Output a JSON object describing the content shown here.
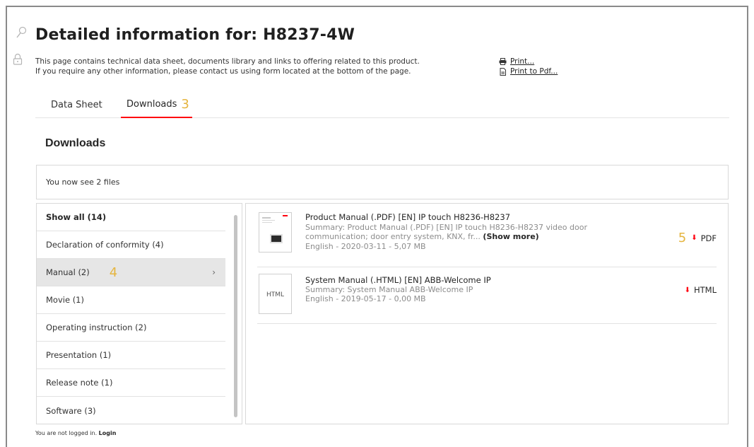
{
  "header": {
    "title": "Detailed information for: H8237-4W",
    "description_line1": "This page contains technical data sheet, documents library and links to offering related to this product.",
    "description_line2": "If you require any other information, please contact us using form located at the bottom of the page.",
    "print_label": "Print...",
    "print_pdf_label": "Print to Pdf..."
  },
  "tabs": [
    {
      "label": "Data Sheet",
      "active": false
    },
    {
      "label": "Downloads",
      "active": true,
      "annotation": "3"
    }
  ],
  "downloads": {
    "section_title": "Downloads",
    "count_text": "You now see 2 files",
    "categories": [
      {
        "label": "Show all (14)",
        "bold": true
      },
      {
        "label": "Declaration of conformity (4)"
      },
      {
        "label": "Manual (2)",
        "active": true,
        "annotation": "4"
      },
      {
        "label": "Movie (1)"
      },
      {
        "label": "Operating instruction (2)"
      },
      {
        "label": "Presentation (1)"
      },
      {
        "label": "Release note (1)"
      },
      {
        "label": "Software (3)"
      }
    ],
    "files": [
      {
        "title": "Product Manual (.PDF) [EN] IP touch H8236-H8237",
        "summary": "Summary: Product Manual (.PDF) [EN] IP touch H8236-H8237 video door communication; door entry system, KNX, fr...",
        "show_more": "(Show more)",
        "meta": "English - 2020-03-11 - 5,07 MB",
        "download_label": "PDF",
        "annotation": "5",
        "thumb_type": "pdf"
      },
      {
        "title": "System Manual (.HTML) [EN] ABB-Welcome IP",
        "summary": "Summary: System Manual ABB-Welcome IP",
        "meta": "English - 2019-05-17 - 0,00 MB",
        "download_label": "HTML",
        "thumb_type": "html",
        "thumb_text": "HTML"
      }
    ]
  },
  "footer": {
    "text": "You are not logged in.",
    "login_label": "Login"
  },
  "colors": {
    "accent_red": "#ff000f",
    "annotation_gold": "#e5b53f"
  },
  "icons": [
    "search-icon",
    "lock-icon",
    "printer-icon",
    "pdf-document-icon",
    "chevron-right-icon",
    "download-arrow-icon"
  ]
}
